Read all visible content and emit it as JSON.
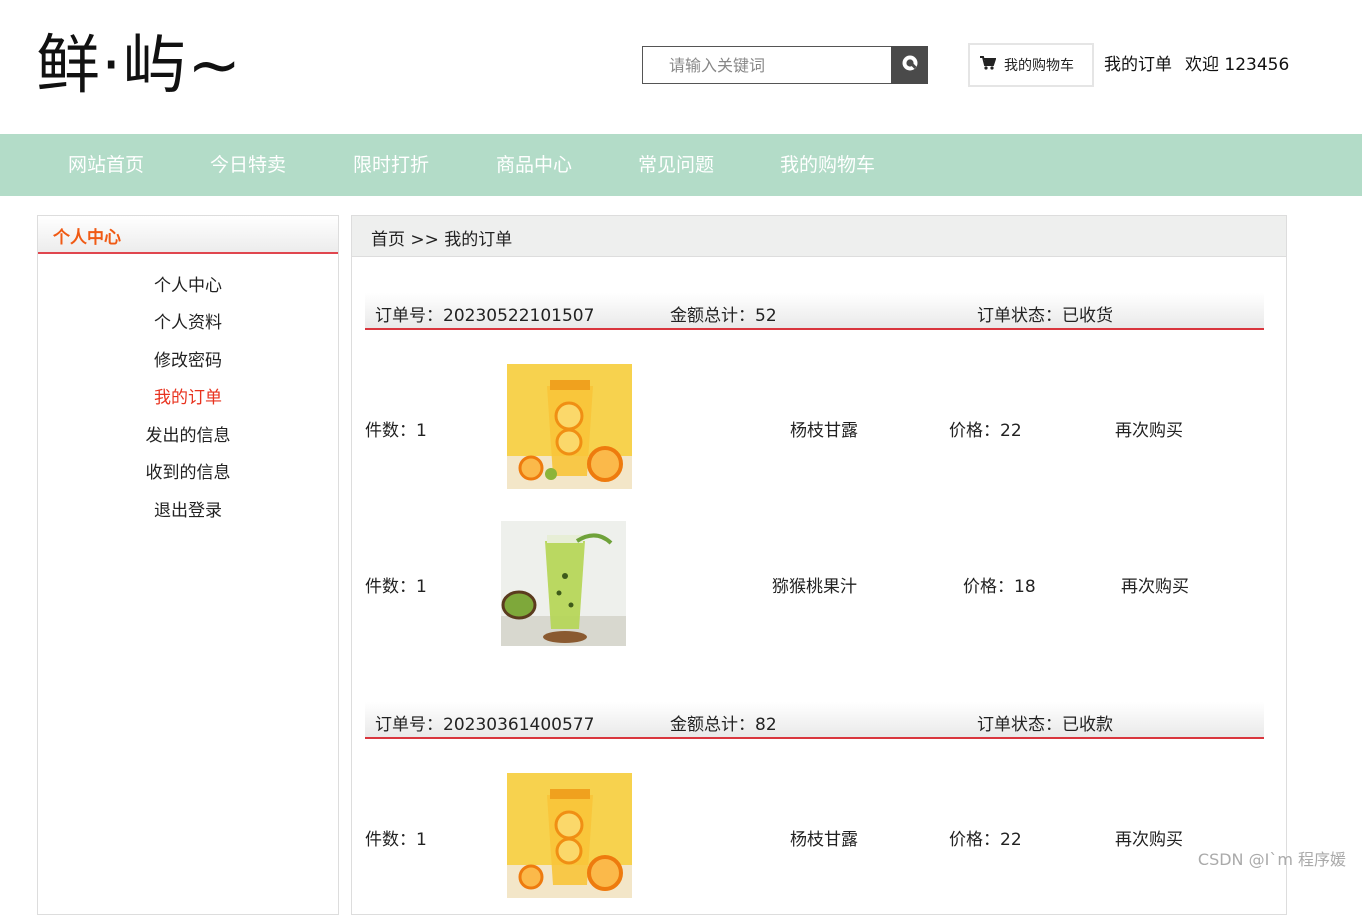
{
  "header": {
    "logo_text": "鲜·屿~",
    "search": {
      "placeholder": "请输入关键词",
      "value": ""
    },
    "cart_button_label": "我的购物车",
    "my_orders_link": "我的订单",
    "welcome_text": "欢迎 123456"
  },
  "nav": {
    "items": [
      {
        "label": "网站首页"
      },
      {
        "label": "今日特卖"
      },
      {
        "label": "限时打折"
      },
      {
        "label": "商品中心"
      },
      {
        "label": "常见问题"
      },
      {
        "label": "我的购物车"
      }
    ]
  },
  "sidebar": {
    "title": "个人中心",
    "items": [
      {
        "label": "个人中心"
      },
      {
        "label": "个人资料"
      },
      {
        "label": "修改密码"
      },
      {
        "label": "我的订单",
        "active": true
      },
      {
        "label": "发出的信息"
      },
      {
        "label": "收到的信息"
      },
      {
        "label": "退出登录"
      }
    ]
  },
  "breadcrumb": "首页 >> 我的订单",
  "orders": [
    {
      "order_no": "订单号：20230522101507",
      "total": "金额总计：52",
      "status": "订单状态：已收货",
      "items": [
        {
          "qty": "件数：1",
          "image": "orange-drink-image",
          "name": "杨枝甘露",
          "price": "价格：22",
          "action": "再次购买"
        },
        {
          "qty": "件数：1",
          "image": "kiwi-drink-image",
          "name": "猕猴桃果汁",
          "price": "价格：18",
          "action": "再次购买"
        }
      ]
    },
    {
      "order_no": "订单号：20230361400577",
      "total": "金额总计：82",
      "status": "订单状态：已收款",
      "items": [
        {
          "qty": "件数：1",
          "image": "orange-drink-image",
          "name": "杨枝甘露",
          "price": "价格：22",
          "action": "再次购买"
        }
      ]
    }
  ],
  "watermark": "CSDN @I`m 程序媛",
  "colors": {
    "nav_bg": "#b3dcc8",
    "accent_red": "#e8321e",
    "sidebar_title": "#f05a14"
  }
}
